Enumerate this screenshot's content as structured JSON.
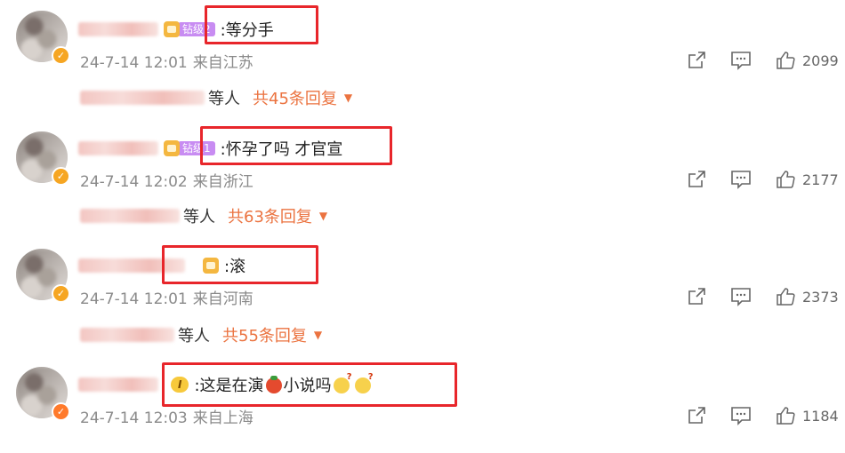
{
  "comments": [
    {
      "content": ":等分手",
      "badge_level": "钻级2",
      "time": "24-7-14 12:01",
      "location": "来自江苏",
      "likes": "2099",
      "reply_who": "等人",
      "reply_count": "共45条回复",
      "reply_caret": "▼"
    },
    {
      "content": ":怀孕了吗 才官宣",
      "badge_level": "钻级1",
      "time": "24-7-14 12:02",
      "location": "来自浙江",
      "likes": "2177",
      "reply_who": "等人",
      "reply_count": "共63条回复",
      "reply_caret": "▼"
    },
    {
      "content": ":滚",
      "time": "24-7-14 12:01",
      "location": "来自河南",
      "likes": "2373",
      "reply_who": "等人",
      "reply_count": "共55条回复",
      "reply_caret": "▼"
    },
    {
      "content_a": ":这是在演",
      "content_b": "小说吗",
      "vip_label": "I",
      "time": "24-7-14 12:03",
      "location": "来自上海",
      "likes": "1184"
    }
  ],
  "colors": {
    "accent": "#eb7340",
    "highlight_box": "#e8262b",
    "meta": "#8a8a8a"
  }
}
